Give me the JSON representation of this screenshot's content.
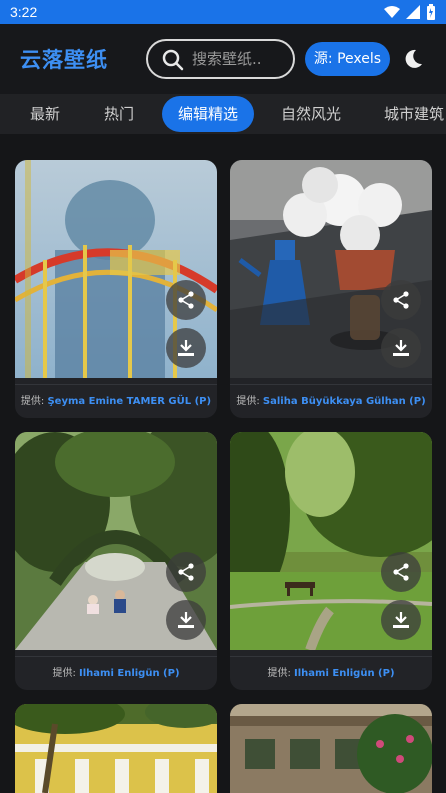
{
  "status": {
    "time": "3:22"
  },
  "header": {
    "title": "云落壁纸",
    "search_placeholder": "搜索壁纸..",
    "source_label": "源: Pexels"
  },
  "tabs": [
    {
      "label": "最新",
      "active": false
    },
    {
      "label": "热门",
      "active": false
    },
    {
      "label": "编辑精选",
      "active": true
    },
    {
      "label": "自然风光",
      "active": false
    },
    {
      "label": "城市建筑",
      "active": false
    }
  ],
  "cards": [
    {
      "prefix": "提供: ",
      "author": "Şeyma Emine TAMER GÜL (P)"
    },
    {
      "prefix": "提供: ",
      "author": "Saliha Büyükkaya Gülhan (P)"
    },
    {
      "prefix": "提供: ",
      "author": "Ilhami Enligün (P)"
    },
    {
      "prefix": "提供: ",
      "author": "Ilhami Enligün (P)"
    }
  ],
  "colors": {
    "accent": "#1a73e8",
    "link": "#3d8ff3",
    "background": "#151618"
  }
}
